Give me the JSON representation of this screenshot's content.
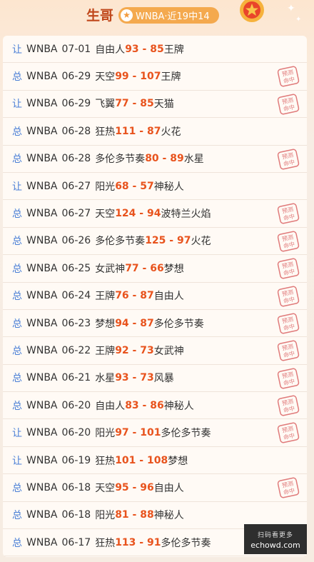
{
  "header": {
    "title": "生哥",
    "badge": "WNBA·近19中14"
  },
  "stamp_text": "预测命中",
  "watermark": {
    "line1": "扫码看更多",
    "line2": "echowd.com"
  },
  "rows": [
    {
      "type": "让",
      "league": "WNBA",
      "date": "07-01",
      "home": "自由人",
      "score": "93 - 85",
      "away": "王牌",
      "hit": false
    },
    {
      "type": "总",
      "league": "WNBA",
      "date": "06-29",
      "home": "天空",
      "score": "99 - 107",
      "away": "王牌",
      "hit": true
    },
    {
      "type": "让",
      "league": "WNBA",
      "date": "06-29",
      "home": "飞翼",
      "score": "77 - 85",
      "away": "天猫",
      "hit": true
    },
    {
      "type": "总",
      "league": "WNBA",
      "date": "06-28",
      "home": "狂热",
      "score": "111 - 87",
      "away": "火花",
      "hit": false
    },
    {
      "type": "总",
      "league": "WNBA",
      "date": "06-28",
      "home": "多伦多节奏",
      "score": "80 - 89",
      "away": "水星",
      "hit": true
    },
    {
      "type": "让",
      "league": "WNBA",
      "date": "06-27",
      "home": "阳光",
      "score": "68 - 57",
      "away": "神秘人",
      "hit": false
    },
    {
      "type": "总",
      "league": "WNBA",
      "date": "06-27",
      "home": "天空",
      "score": "124 - 94",
      "away": "波特兰火焰",
      "hit": true
    },
    {
      "type": "总",
      "league": "WNBA",
      "date": "06-26",
      "home": "多伦多节奏",
      "score": "125 - 97",
      "away": "火花",
      "hit": true
    },
    {
      "type": "总",
      "league": "WNBA",
      "date": "06-25",
      "home": "女武神",
      "score": "77 - 66",
      "away": "梦想",
      "hit": true
    },
    {
      "type": "总",
      "league": "WNBA",
      "date": "06-24",
      "home": "王牌",
      "score": "76 - 87",
      "away": "自由人",
      "hit": true
    },
    {
      "type": "总",
      "league": "WNBA",
      "date": "06-23",
      "home": "梦想",
      "score": "94 - 87",
      "away": "多伦多节奏",
      "hit": true
    },
    {
      "type": "总",
      "league": "WNBA",
      "date": "06-22",
      "home": "王牌",
      "score": "92 - 73",
      "away": "女武神",
      "hit": true
    },
    {
      "type": "总",
      "league": "WNBA",
      "date": "06-21",
      "home": "水星",
      "score": "93 - 73",
      "away": "风暴",
      "hit": true
    },
    {
      "type": "总",
      "league": "WNBA",
      "date": "06-20",
      "home": "自由人",
      "score": "83 - 86",
      "away": "神秘人",
      "hit": true
    },
    {
      "type": "让",
      "league": "WNBA",
      "date": "06-20",
      "home": "阳光",
      "score": "97 - 101",
      "away": "多伦多节奏",
      "hit": true
    },
    {
      "type": "让",
      "league": "WNBA",
      "date": "06-19",
      "home": "狂热",
      "score": "101 - 108",
      "away": "梦想",
      "hit": false
    },
    {
      "type": "总",
      "league": "WNBA",
      "date": "06-18",
      "home": "天空",
      "score": "95 - 96",
      "away": "自由人",
      "hit": true
    },
    {
      "type": "总",
      "league": "WNBA",
      "date": "06-18",
      "home": "阳光",
      "score": "81 - 88",
      "away": "神秘人",
      "hit": false
    },
    {
      "type": "总",
      "league": "WNBA",
      "date": "06-17",
      "home": "狂热",
      "score": "113 - 91",
      "away": "多伦多节奏",
      "hit": false
    }
  ]
}
